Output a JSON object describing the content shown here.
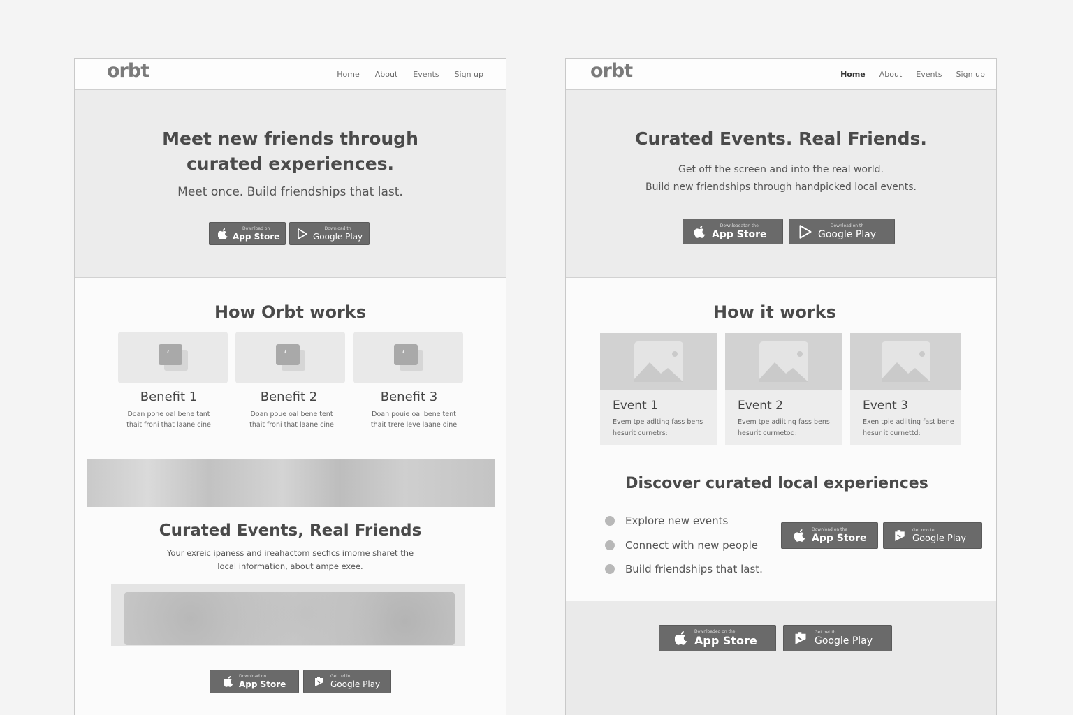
{
  "variant_a": {
    "logo": "orbt",
    "nav": [
      "Home",
      "About",
      "Events",
      "Sign up"
    ],
    "hero": {
      "title_line1": "Meet new friends through",
      "title_line2": "curated experiences.",
      "subtitle": "Meet once. Build friendships that last."
    },
    "hero_buttons": {
      "app_small": "Download on",
      "app_big": "App Store",
      "play_small": "Download th",
      "play_big": "Google Play"
    },
    "how_title": "How Orbt works",
    "benefits": [
      {
        "title": "Benefit 1",
        "desc_line1": "Doan pone oal bene tant",
        "desc_line2": "thait froni that laane cine"
      },
      {
        "title": "Benefit 2",
        "desc_line1": "Doan poue oal bene tent",
        "desc_line2": "thait froni that laane cine"
      },
      {
        "title": "Benefit 3",
        "desc_line1": "Doan pouie oal bene tent",
        "desc_line2": "thait trere leve laane oine"
      }
    ],
    "curated_title": "Curated Events, Real Friends",
    "curated_desc_line1": "Your exreic ipaness and ireahactom secfics imome sharet the",
    "curated_desc_line2": "local information, about ampe exee.",
    "bottom_buttons": {
      "app_small": "Download on",
      "app_big": "App Store",
      "play_small": "Get trd in",
      "play_big": "Google Play"
    }
  },
  "variant_b": {
    "logo": "orbt",
    "nav": [
      "Home",
      "About",
      "Events",
      "Sign up"
    ],
    "nav_active": "Home",
    "hero": {
      "title": "Curated Events. Real Friends.",
      "subtitle_line1": "Get off the screen and into the real world.",
      "subtitle_line2": "Build new friendships through handpicked local events."
    },
    "hero_buttons": {
      "app_small": "Downloadatan the",
      "app_big": "App Store",
      "play_small": "Download on th",
      "play_big": "Google Play"
    },
    "how_title": "How it works",
    "events": [
      {
        "title": "Event 1",
        "desc_line1": "Evem tpe adlting fass bens",
        "desc_line2": "hesurit curnetrs:"
      },
      {
        "title": "Event 2",
        "desc_line1": "Evem tpe adiiting fass bens",
        "desc_line2": "hesurit curmetod:"
      },
      {
        "title": "Event 3",
        "desc_line1": "Exen tpie adiiting fast bene",
        "desc_line2": "hesur it curnettd:"
      }
    ],
    "discover_title": "Discover curated local experiences",
    "bullets": [
      "Explore new events",
      "Connect with new people",
      "Build friendships that last."
    ],
    "discover_buttons": {
      "app_small": "Download on the",
      "app_big": "App Store",
      "play_small": "Get ooo te",
      "play_big": "Google Play"
    },
    "footer_buttons": {
      "app_small": "Downloaded on the",
      "app_big": "App Store",
      "play_small": "Get bet th",
      "play_big": "Google Play"
    }
  }
}
